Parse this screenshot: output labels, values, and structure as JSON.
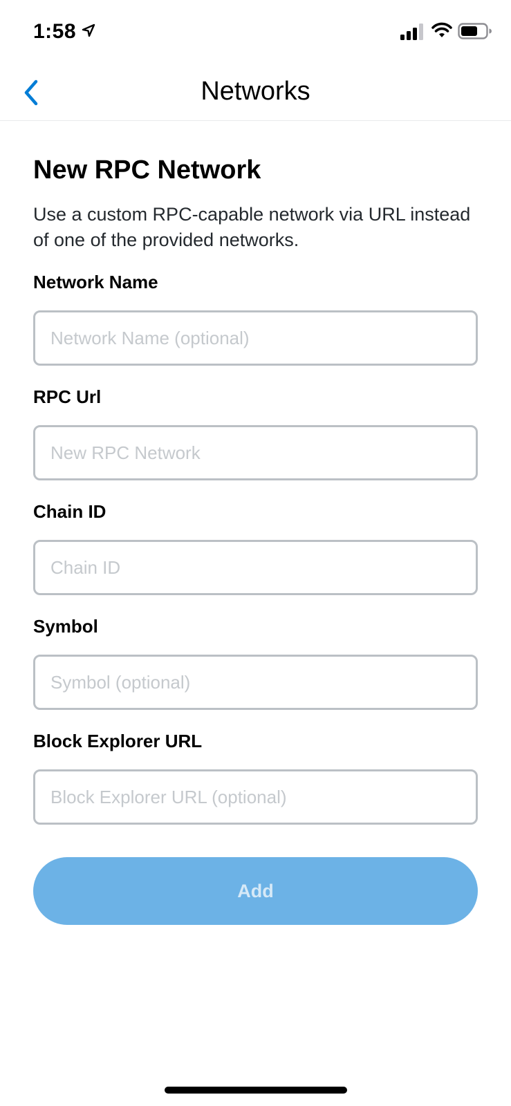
{
  "status_bar": {
    "time": "1:58",
    "icons": [
      "location-arrow-icon",
      "cellular-signal-icon",
      "wifi-icon",
      "battery-icon"
    ]
  },
  "nav": {
    "title": "Networks",
    "back_icon": "chevron-left-icon"
  },
  "form": {
    "title": "New RPC Network",
    "description": "Use a custom RPC-capable network via URL instead of one of the provided networks.",
    "fields": [
      {
        "label": "Network Name",
        "value": "",
        "placeholder": "Network Name (optional)"
      },
      {
        "label": "RPC Url",
        "value": "",
        "placeholder": "New RPC Network"
      },
      {
        "label": "Chain ID",
        "value": "",
        "placeholder": "Chain ID"
      },
      {
        "label": "Symbol",
        "value": "",
        "placeholder": "Symbol (optional)"
      },
      {
        "label": "Block Explorer URL",
        "value": "",
        "placeholder": "Block Explorer URL (optional)"
      }
    ],
    "submit_label": "Add"
  },
  "colors": {
    "accent": "#037dd6",
    "button_disabled_bg": "#6cb2e6",
    "button_disabled_text": "#d6e9f7",
    "input_border": "#bbc0c5",
    "placeholder": "#c5c9cd"
  }
}
